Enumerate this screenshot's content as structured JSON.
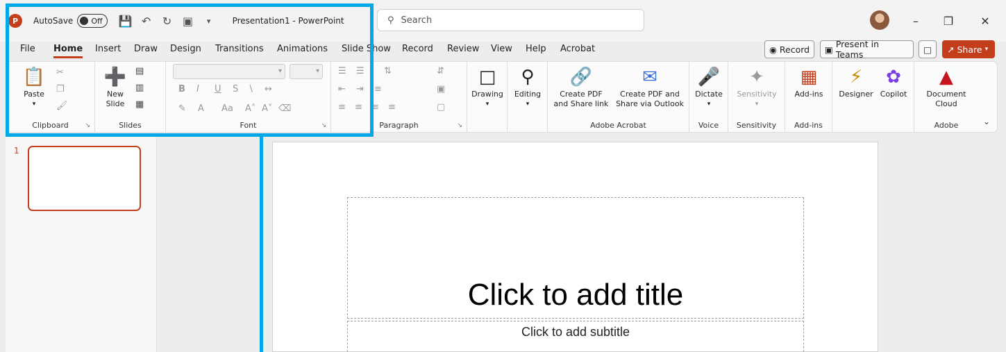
{
  "titlebar": {
    "logo": "P",
    "autosave_label": "AutoSave",
    "autosave_state": "Off",
    "document_title": "Presentation1 - PowerPoint",
    "search_placeholder": "Search"
  },
  "tabs": [
    "File",
    "Home",
    "Insert",
    "Draw",
    "Design",
    "Transitions",
    "Animations",
    "Slide Show",
    "Record",
    "Review",
    "View",
    "Help",
    "Acrobat"
  ],
  "active_tab": "Home",
  "actions": {
    "record": "Record",
    "present": "Present in Teams",
    "share": "Share"
  },
  "ribbon": {
    "clipboard": {
      "label": "Clipboard",
      "paste": "Paste"
    },
    "slides": {
      "label": "Slides",
      "new_slide_1": "New",
      "new_slide_2": "Slide"
    },
    "font": {
      "label": "Font",
      "bold": "B",
      "italic": "I",
      "underline": "U",
      "shadow": "S",
      "case": "Aa"
    },
    "paragraph": {
      "label": "Paragraph"
    },
    "drawing": "Drawing",
    "editing": "Editing",
    "acrobat": {
      "label": "Adobe Acrobat",
      "create_pdf_1": "Create PDF",
      "create_pdf_2": "and Share link",
      "outlook_1": "Create PDF and",
      "outlook_2": "Share via Outlook"
    },
    "voice": {
      "label": "Voice",
      "dictate": "Dictate"
    },
    "sensitivity": {
      "label": "Sensitivity",
      "button": "Sensitivity"
    },
    "addins": {
      "label": "Add-ins",
      "button": "Add-ins"
    },
    "designer": "Designer",
    "copilot": "Copilot",
    "adobe": {
      "label": "Adobe",
      "doc_1": "Document",
      "doc_2": "Cloud"
    }
  },
  "slides_pane": {
    "slide_number": "1"
  },
  "slide": {
    "title_placeholder": "Click to add title",
    "subtitle_placeholder": "Click to add subtitle"
  },
  "colors": {
    "accent": "#c43e1c",
    "highlight": "#00a8e8"
  }
}
